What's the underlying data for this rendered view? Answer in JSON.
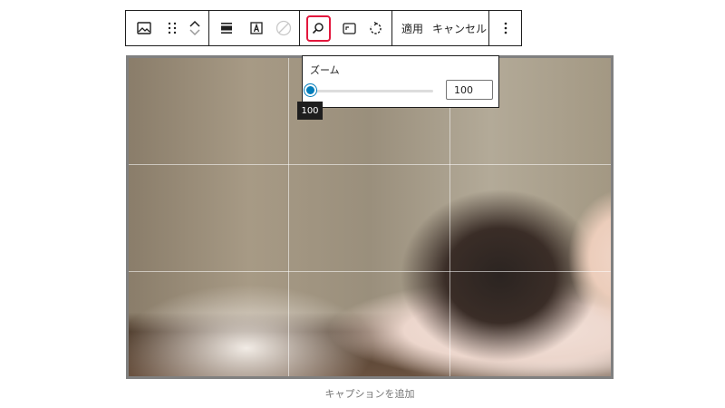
{
  "toolbar": {
    "icons": {
      "image_block": "image-icon",
      "drag": "drag-handle-icon",
      "move_up": "chevron-up-icon",
      "move_down": "chevron-down-icon",
      "align": "align-icon",
      "alt_text": "text-overlay-icon",
      "duotone": "duotone-icon",
      "zoom": "zoom-icon",
      "aspect_ratio": "aspect-ratio-icon",
      "rotate": "rotate-icon",
      "more": "more-vertical-icon"
    },
    "apply_label": "適用",
    "cancel_label": "キャンセル",
    "accent_color": "#e3173d"
  },
  "zoom_popover": {
    "label": "ズーム",
    "value": "100",
    "slider_level": 0,
    "slider_color": "#007cba",
    "tooltip": "100"
  },
  "image": {
    "description_icon": "photo"
  },
  "caption": {
    "placeholder": "キャプションを追加"
  }
}
